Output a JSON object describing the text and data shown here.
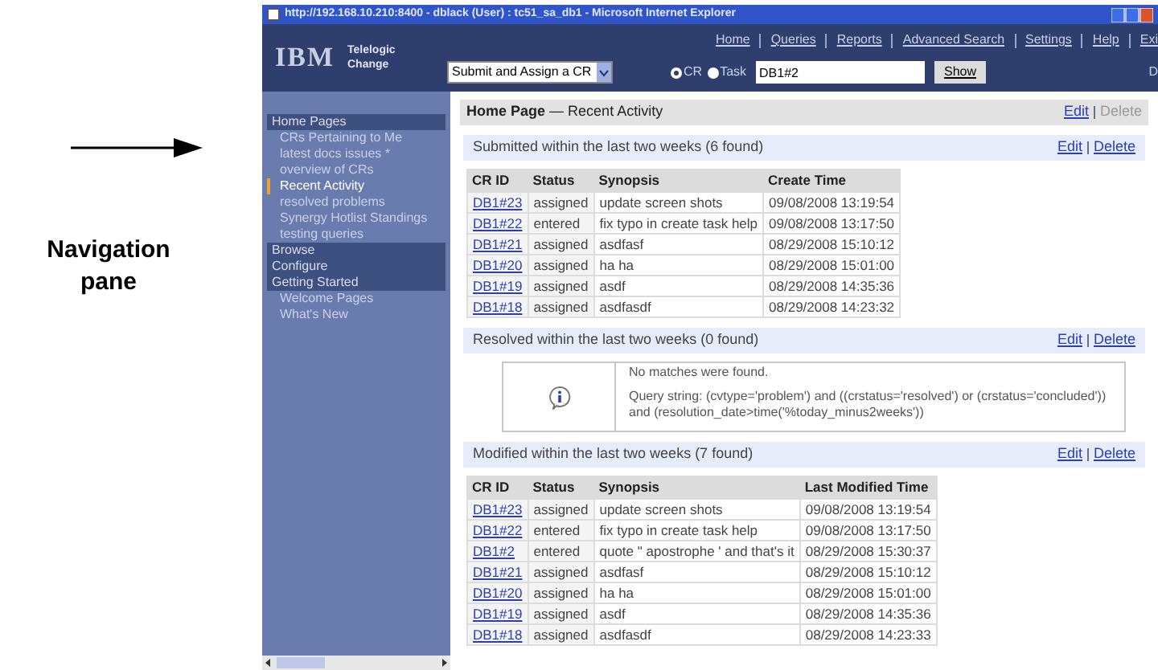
{
  "annotation": {
    "label": "Navigation pane"
  },
  "window": {
    "title": "http://192.168.10.210:8400 - dblack (User) : tc51_sa_db1 - Microsoft Internet Explorer"
  },
  "header": {
    "logo": "IBM",
    "product": [
      "Telelogic",
      "Change"
    ],
    "menu": [
      "Home",
      "Queries",
      "Reports",
      "Advanced Search",
      "Settings",
      "Help",
      "Exi"
    ],
    "create_select": {
      "value": "Submit and Assign a CR"
    },
    "radios": [
      {
        "label": "CR",
        "selected": true
      },
      {
        "label": "Task",
        "selected": false
      }
    ],
    "search": {
      "value": "DB1#2"
    },
    "show_button": "Show",
    "cut_text": "D"
  },
  "sidebar": {
    "sections": [
      {
        "label": "Home Pages",
        "children": [
          {
            "label": "CRs Pertaining to Me",
            "selected": false
          },
          {
            "label": "latest docs issues *",
            "selected": false
          },
          {
            "label": "overview of CRs",
            "selected": false
          },
          {
            "label": "Recent Activity",
            "selected": true
          },
          {
            "label": "resolved problems",
            "selected": false
          },
          {
            "label": "Synergy Hotlist Standings",
            "selected": false
          },
          {
            "label": "testing queries",
            "selected": false
          }
        ]
      },
      {
        "label": "Browse"
      },
      {
        "label": "Configure"
      },
      {
        "label": "Getting Started",
        "children": [
          {
            "label": "Welcome Pages",
            "selected": false
          },
          {
            "label": "What's New",
            "selected": false
          }
        ]
      }
    ]
  },
  "page_header": {
    "title": "Home Page",
    "subtitle": "— Recent Activity",
    "actions": [
      {
        "label": "Edit",
        "disabled": false
      },
      {
        "label": "Delete",
        "disabled": true
      }
    ]
  },
  "sections": [
    {
      "kind": "table",
      "title": "Submitted within the last two weeks (6 found)",
      "actions": [
        {
          "label": "Edit",
          "disabled": false
        },
        {
          "label": "Delete",
          "disabled": false
        }
      ],
      "columns": [
        "CR ID",
        "Status",
        "Synopsis",
        "Create Time"
      ],
      "rows": [
        [
          "DB1#23",
          "assigned",
          "update screen shots",
          "09/08/2008 13:19:54"
        ],
        [
          "DB1#22",
          "entered",
          "fix typo in create task help",
          "09/08/2008 13:17:50"
        ],
        [
          "DB1#21",
          "assigned",
          "asdfasf",
          "08/29/2008 15:10:12"
        ],
        [
          "DB1#20",
          "assigned",
          "ha ha",
          "08/29/2008 15:01:00"
        ],
        [
          "DB1#19",
          "assigned",
          "asdf",
          "08/29/2008 14:35:36"
        ],
        [
          "DB1#18",
          "assigned",
          "asdfasdf",
          "08/29/2008 14:23:32"
        ]
      ]
    },
    {
      "kind": "message",
      "title": "Resolved within the last two weeks (0 found)",
      "actions": [
        {
          "label": "Edit",
          "disabled": false
        },
        {
          "label": "Delete",
          "disabled": false
        }
      ],
      "message": "No matches were found.",
      "query": "Query string: (cvtype='problem') and ((crstatus='resolved') or (crstatus='concluded')) and (resolution_date>time('%today_minus2weeks'))"
    },
    {
      "kind": "table",
      "title": "Modified within the last two weeks (7 found)",
      "actions": [
        {
          "label": "Edit",
          "disabled": false
        },
        {
          "label": "Delete",
          "disabled": false
        }
      ],
      "columns": [
        "CR ID",
        "Status",
        "Synopsis",
        "Last Modified Time"
      ],
      "rows": [
        [
          "DB1#23",
          "assigned",
          "update screen shots",
          "09/08/2008 13:19:54"
        ],
        [
          "DB1#22",
          "entered",
          "fix typo in create task help",
          "09/08/2008 13:17:50"
        ],
        [
          "DB1#2",
          "entered",
          "quote \" apostrophe ' and that's it",
          "08/29/2008 15:30:37"
        ],
        [
          "DB1#21",
          "assigned",
          "asdfasf",
          "08/29/2008 15:10:12"
        ],
        [
          "DB1#20",
          "assigned",
          "ha ha",
          "08/29/2008 15:01:00"
        ],
        [
          "DB1#19",
          "assigned",
          "asdf",
          "08/29/2008 14:35:36"
        ],
        [
          "DB1#18",
          "assigned",
          "asdfasdf",
          "08/29/2008 14:23:33"
        ]
      ]
    }
  ]
}
